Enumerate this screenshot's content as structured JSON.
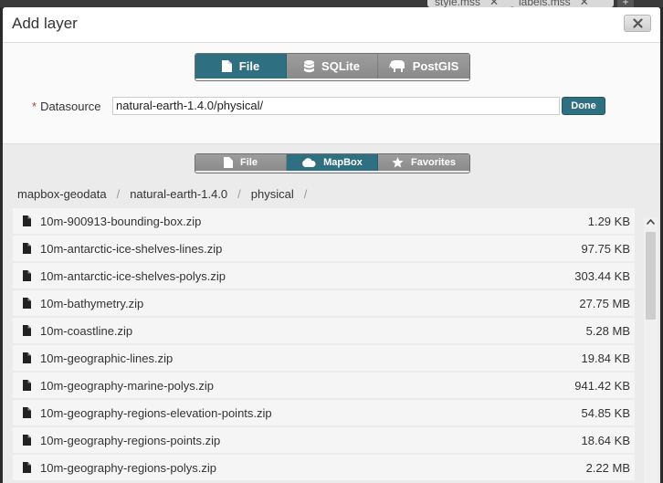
{
  "background_tabs": [
    {
      "label": "style.mss"
    },
    {
      "label": "labels.mss"
    }
  ],
  "modal": {
    "title": "Add layer",
    "close_icon": "close-icon"
  },
  "source_tabs": [
    {
      "label": "File",
      "icon": "file-icon",
      "active": true
    },
    {
      "label": "SQLite",
      "icon": "database-icon",
      "active": false
    },
    {
      "label": "PostGIS",
      "icon": "elephant-icon",
      "active": false
    }
  ],
  "datasource": {
    "required_marker": "*",
    "label": "Datasource",
    "value": "natural-earth-1.4.0/physical/",
    "done_label": "Done"
  },
  "browser_tabs": [
    {
      "label": "File",
      "icon": "file-icon",
      "active": false
    },
    {
      "label": "MapBox",
      "icon": "cloud-icon",
      "active": true
    },
    {
      "label": "Favorites",
      "icon": "star-icon",
      "active": false
    }
  ],
  "breadcrumb": {
    "items": [
      "mapbox-geodata",
      "natural-earth-1.4.0",
      "physical"
    ],
    "separator": "/"
  },
  "files": [
    {
      "name": "10m-900913-bounding-box.zip",
      "size": "1.29 KB"
    },
    {
      "name": "10m-antarctic-ice-shelves-lines.zip",
      "size": "97.75 KB"
    },
    {
      "name": "10m-antarctic-ice-shelves-polys.zip",
      "size": "303.44 KB"
    },
    {
      "name": "10m-bathymetry.zip",
      "size": "27.75 MB"
    },
    {
      "name": "10m-coastline.zip",
      "size": "5.28 MB"
    },
    {
      "name": "10m-geographic-lines.zip",
      "size": "19.84 KB"
    },
    {
      "name": "10m-geography-marine-polys.zip",
      "size": "941.42 KB"
    },
    {
      "name": "10m-geography-regions-elevation-points.zip",
      "size": "54.85 KB"
    },
    {
      "name": "10m-geography-regions-points.zip",
      "size": "18.64 KB"
    },
    {
      "name": "10m-geography-regions-polys.zip",
      "size": "2.22 MB"
    }
  ],
  "colors": {
    "accent": "#2f6f82",
    "inactive_button": "#8f8f8f"
  }
}
